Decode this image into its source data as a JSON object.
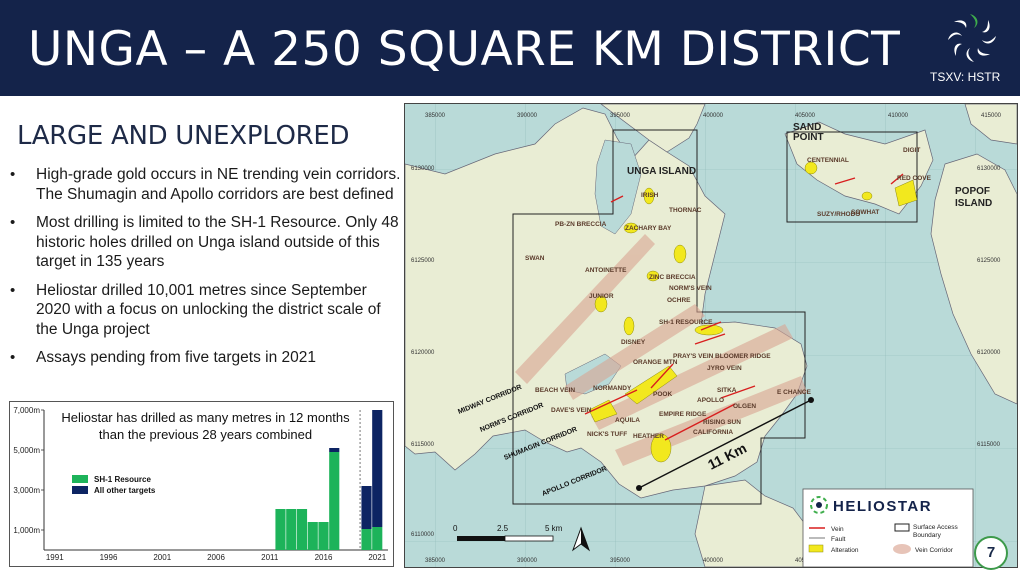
{
  "header": {
    "title": "UNGA – A 250 SQUARE KM DISTRICT",
    "ticker": "TSXV: HSTR"
  },
  "subtitle": "LARGE AND UNEXPLORED",
  "bullets": [
    "High-grade gold occurs in NE trending vein corridors. The Shumagin and Apollo corridors are best defined",
    "Most drilling is limited to the SH-1 Resource. Only 48 historic holes drilled on Unga island outside of this target in 135 years",
    "Heliostar drilled 10,001 metres since September 2020 with a focus on unlocking the district scale of the Unga project",
    "Assays pending from five targets in 2021"
  ],
  "chart_data": {
    "type": "bar",
    "title": "Heliostar has drilled as many metres in 12 months than the previous 28 years combined",
    "x": [
      1991,
      1996,
      2001,
      2006,
      2011,
      2016,
      2021
    ],
    "ylim": [
      0,
      7000
    ],
    "y_ticks": [
      "1,000m",
      "3,000m",
      "5,000m",
      "7,000m"
    ],
    "x_ticks": [
      "1991",
      "1996",
      "2001",
      "2006",
      "2011",
      "2016",
      "2021"
    ],
    "cumulative": true,
    "series": [
      {
        "name": "SH-1 Resource",
        "color": "#1db35a",
        "points": [
          [
            2011,
            0
          ],
          [
            2012,
            2050
          ],
          [
            2013,
            2050
          ],
          [
            2014,
            2050
          ],
          [
            2015,
            1400
          ],
          [
            2016,
            1400
          ],
          [
            2017,
            4900
          ],
          [
            2018,
            0
          ],
          [
            2019,
            0
          ],
          [
            2020,
            1050
          ],
          [
            2021,
            1150
          ]
        ]
      },
      {
        "name": "All other targets",
        "color": "#0d2463",
        "points": [
          [
            2011,
            0
          ],
          [
            2012,
            0
          ],
          [
            2013,
            0
          ],
          [
            2014,
            0
          ],
          [
            2015,
            0
          ],
          [
            2016,
            0
          ],
          [
            2017,
            200
          ],
          [
            2018,
            0
          ],
          [
            2019,
            0
          ],
          [
            2020,
            2150
          ],
          [
            2021,
            5850
          ]
        ]
      }
    ]
  },
  "map": {
    "coords_top": [
      "385000",
      "390000",
      "395000",
      "400000",
      "405000",
      "410000",
      "415000"
    ],
    "coords_bottom": [
      "385000",
      "390000",
      "395000",
      "400000",
      "405"
    ],
    "coords_left": [
      "6130000",
      "6125000",
      "6120000",
      "6115000",
      "6110000"
    ],
    "coords_right": [
      "6130000",
      "6125000",
      "6120000",
      "6115000"
    ],
    "islands": [
      "UNGA ISLAND",
      "SAND POINT",
      "POPOF ISLAND"
    ],
    "targets": [
      "IRISH",
      "THORNAC",
      "ZACHARY BAY",
      "PB-ZN BRECCIA",
      "SWAN",
      "ANTOINETTE",
      "ZINC BRECCIA",
      "NORM'S VEIN",
      "OCHRE",
      "JUNIOR",
      "SH-1 RESOURCE",
      "DISNEY",
      "ORANGE MTN",
      "PRAY'S VEIN",
      "BLOOMER RIDGE",
      "JYRO VEIN",
      "BEACH VEIN",
      "NORMANDY",
      "POOK",
      "SITKA",
      "APOLLO",
      "OLGEN",
      "E CHANCE",
      "DAVE'S VEIN",
      "AQUILA",
      "EMPIRE RIDGE",
      "RISING SUN",
      "CALIFORNIA",
      "NICK'S TUFF",
      "HEATHER",
      "CENTENNIAL",
      "DIGIT",
      "RED COVE",
      "SOWHAT",
      "SUZY/RHODO"
    ],
    "corridors": [
      "MIDWAY CORRIDOR",
      "NORM'S CORRIDOR",
      "SHUMAGIN CORRIDOR",
      "APOLLO CORRIDOR"
    ],
    "distance_label": "11 Km",
    "scale": [
      "0",
      "2.5",
      "5 km"
    ],
    "brand": "HELIOSTAR",
    "legend": {
      "vein": "Vein",
      "fault": "Fault",
      "alteration": "Alteration",
      "boundary": "Surface Access Boundary",
      "corridor": "Vein Corridor"
    }
  },
  "page_number": "7",
  "colors": {
    "navy": "#14234a",
    "green": "#1db35a",
    "dark_blue": "#0d2463",
    "sea": "#b9dad8",
    "land": "#e9edd4",
    "alteration": "#f2e81e"
  }
}
